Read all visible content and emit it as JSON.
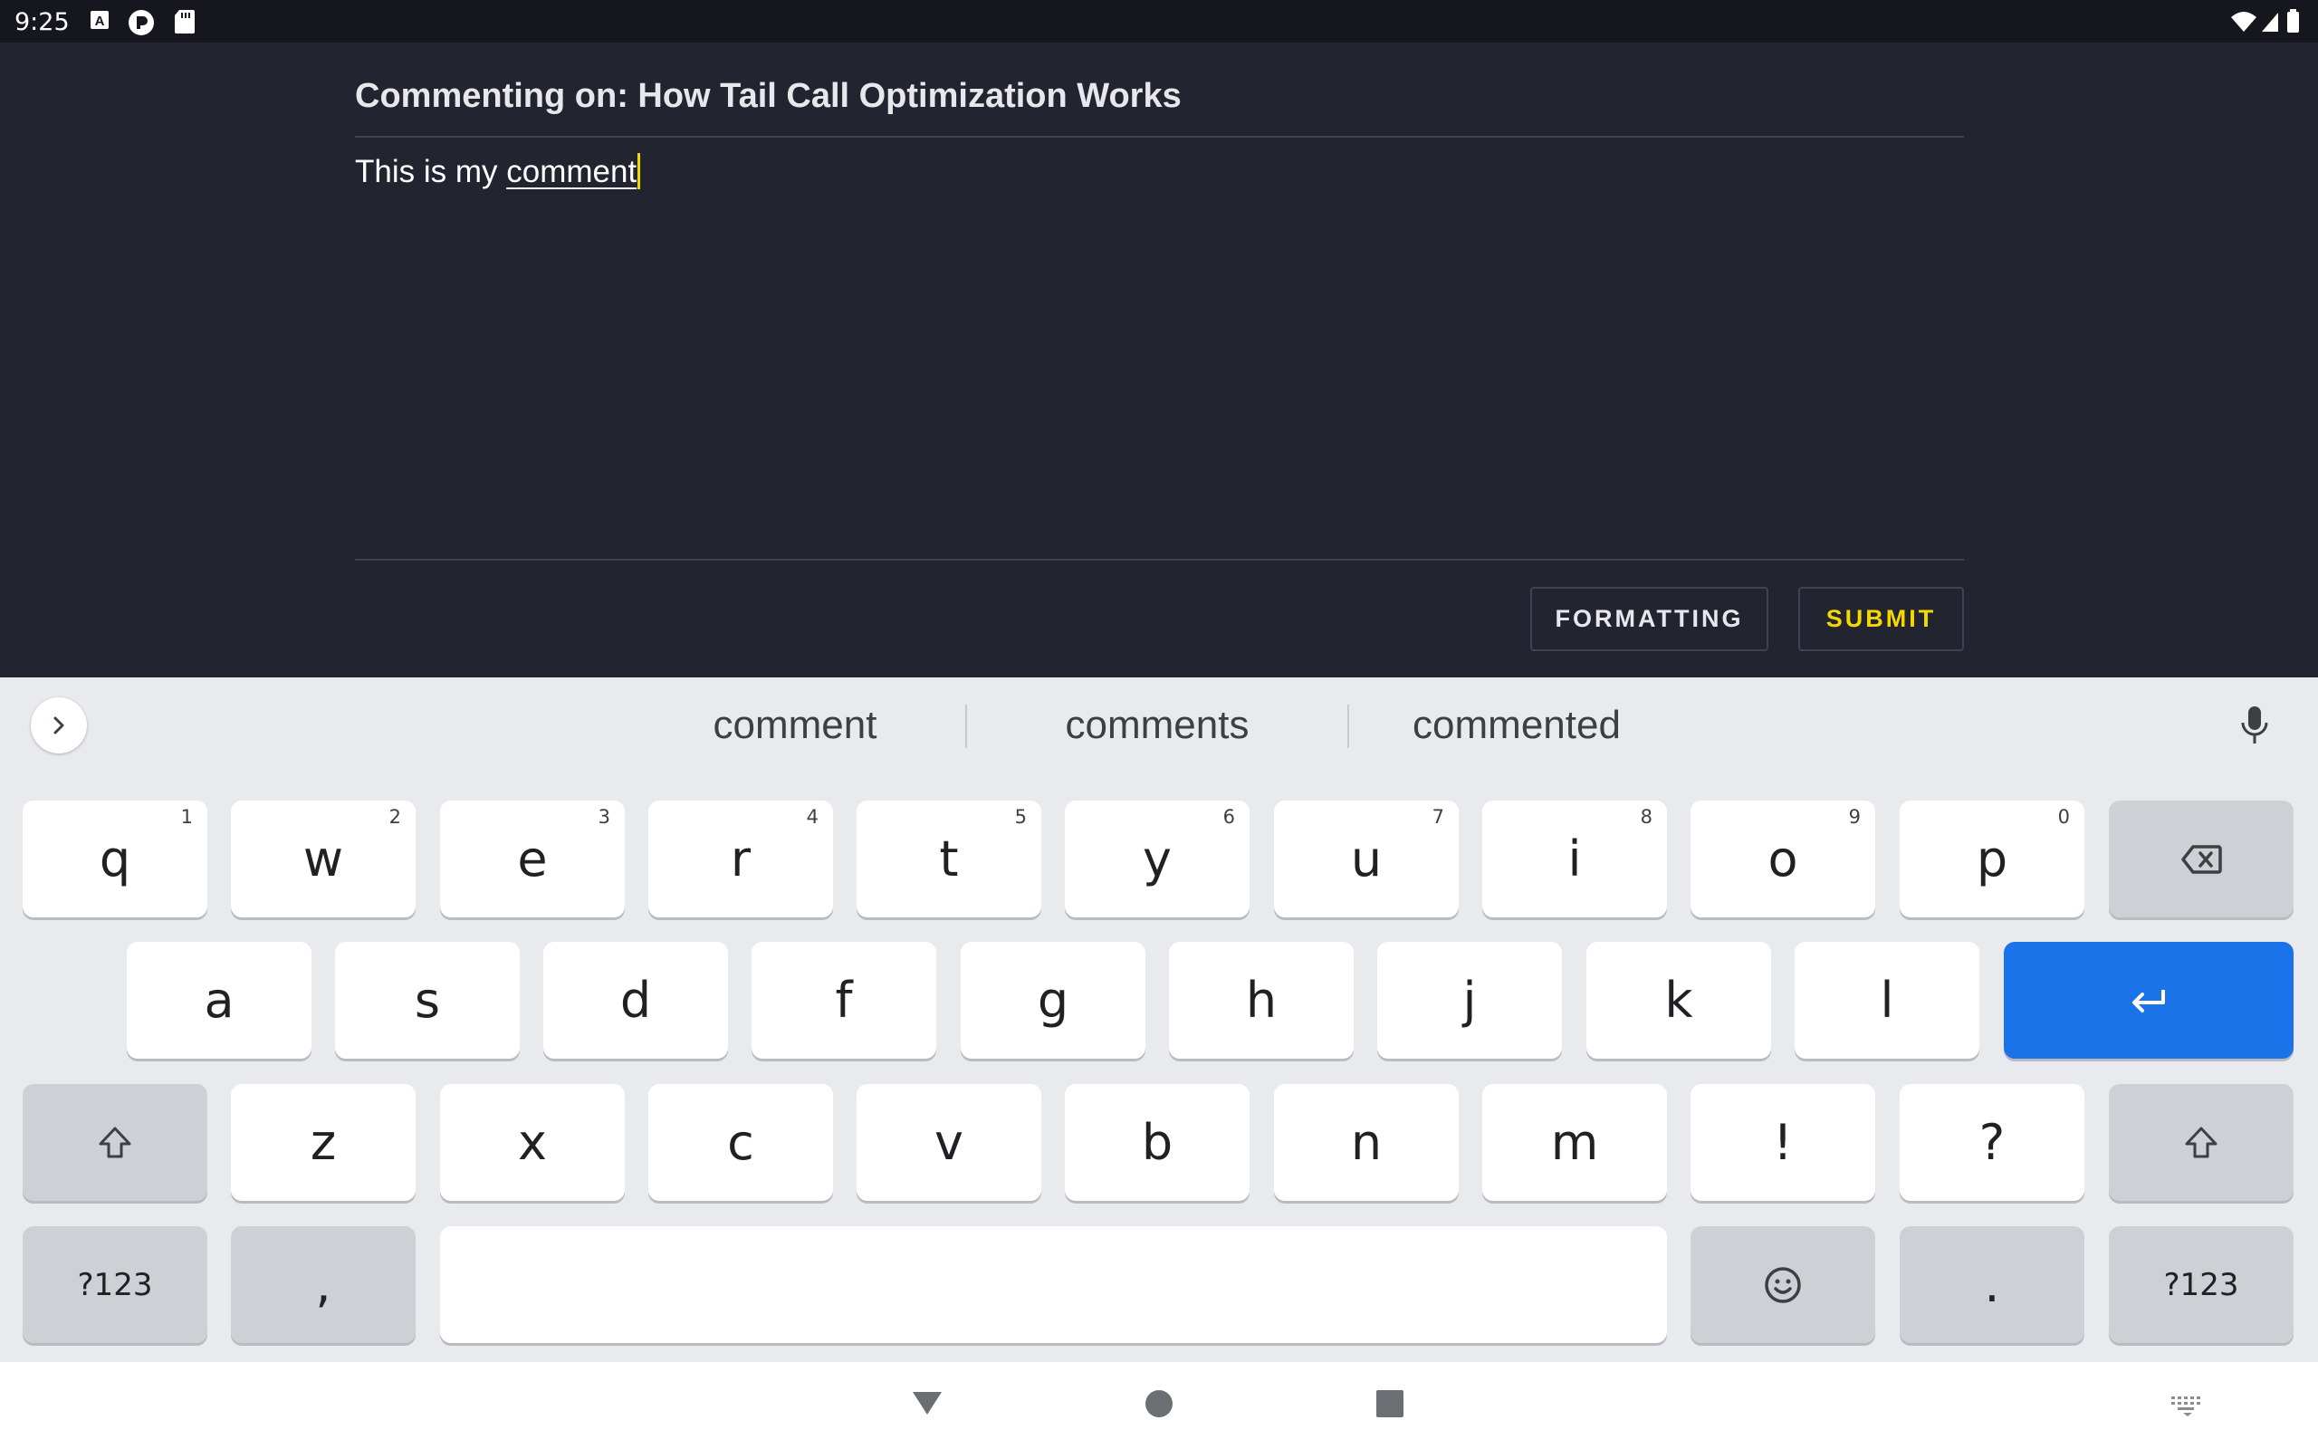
{
  "status_bar": {
    "time": "9:25",
    "left_icons": [
      "a-box-icon",
      "circle-p-icon",
      "sd-card-icon"
    ],
    "right_icons": [
      "wifi-icon",
      "signal-icon",
      "battery-icon"
    ]
  },
  "comment": {
    "title": "Commenting on: How Tail Call Optimization Works",
    "text_plain": "This is my ",
    "text_composing": "comment",
    "formatting_label": "FORMATTING",
    "submit_label": "SUBMIT",
    "accent_color": "#f5d800"
  },
  "keyboard": {
    "suggestions": [
      "comment",
      "comments",
      "commented"
    ],
    "row1": [
      {
        "label": "q",
        "hint": "1"
      },
      {
        "label": "w",
        "hint": "2"
      },
      {
        "label": "e",
        "hint": "3"
      },
      {
        "label": "r",
        "hint": "4"
      },
      {
        "label": "t",
        "hint": "5"
      },
      {
        "label": "y",
        "hint": "6"
      },
      {
        "label": "u",
        "hint": "7"
      },
      {
        "label": "i",
        "hint": "8"
      },
      {
        "label": "o",
        "hint": "9"
      },
      {
        "label": "p",
        "hint": "0"
      }
    ],
    "row2": [
      "a",
      "s",
      "d",
      "f",
      "g",
      "h",
      "j",
      "k",
      "l"
    ],
    "row3": [
      "z",
      "x",
      "c",
      "v",
      "b",
      "n",
      "m",
      "!",
      "?"
    ],
    "symbols_label": "?123",
    "comma_label": ",",
    "period_label": ".",
    "enter_color": "#1a73e8"
  }
}
